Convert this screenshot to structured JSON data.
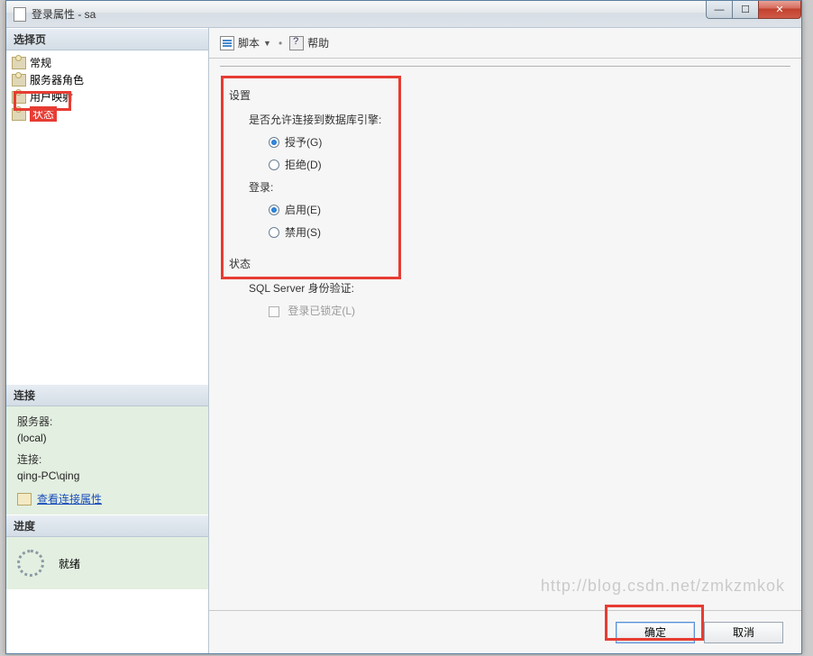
{
  "titlebar": {
    "title": "登录属性 - sa"
  },
  "sidebar": {
    "select_page_header": "选择页",
    "items": [
      {
        "label": "常规"
      },
      {
        "label": "服务器角色"
      },
      {
        "label": "用户映射"
      },
      {
        "label": "状态",
        "selected": true
      }
    ],
    "connection_header": "连接",
    "connection": {
      "server_label": "服务器:",
      "server_value": "(local)",
      "conn_label": "连接:",
      "conn_value": "qing-PC\\qing",
      "view_props": "查看连接属性"
    },
    "progress_header": "进度",
    "progress": {
      "status": "就绪"
    }
  },
  "toolbar": {
    "script": "脚本",
    "help": "帮助"
  },
  "form": {
    "settings_title": "设置",
    "permit_label": "是否允许连接到数据库引擎:",
    "permit_grant": "授予(G)",
    "permit_deny": "拒绝(D)",
    "login_title": "登录:",
    "login_enable": "启用(E)",
    "login_disable": "禁用(S)",
    "status_title": "状态",
    "sqlauth_label": "SQL Server 身份验证:",
    "locked_label": "登录已锁定(L)"
  },
  "footer": {
    "ok": "确定",
    "cancel": "取消"
  },
  "watermark": "http://blog.csdn.net/zmkzmkok"
}
